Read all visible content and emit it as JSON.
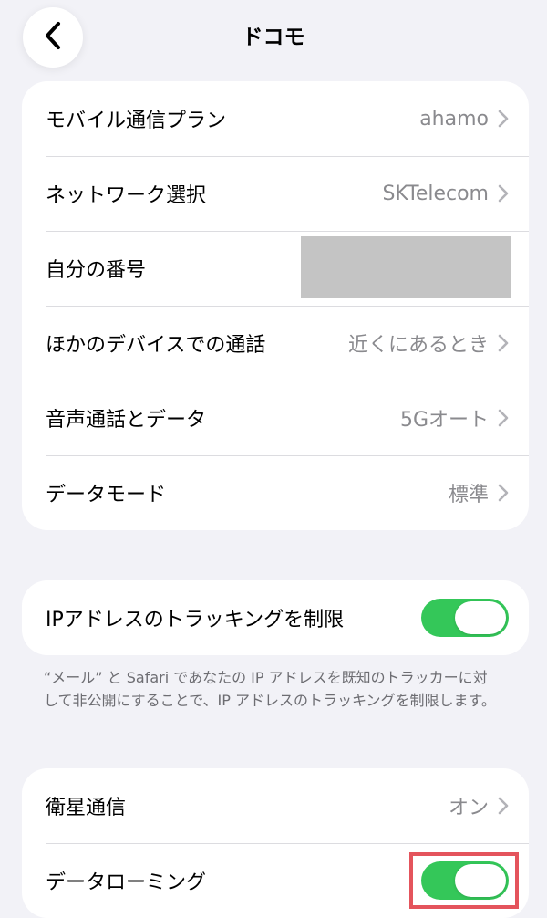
{
  "header": {
    "title": "ドコモ",
    "back_icon": "chevron-left-icon"
  },
  "carrier_settings": {
    "items": [
      {
        "label": "モバイル通信プラン",
        "value": "ahamo"
      },
      {
        "label": "ネットワーク選択",
        "value": "SKTelecom"
      },
      {
        "label": "自分の番号",
        "value": ""
      },
      {
        "label": "ほかのデバイスでの通話",
        "value": "近くにあるとき"
      },
      {
        "label": "音声通話とデータ",
        "value": "5Gオート"
      },
      {
        "label": "データモード",
        "value": "標準"
      }
    ]
  },
  "privacy": {
    "label": "IPアドレスのトラッキングを制限",
    "enabled": true,
    "footnote": "“メール” と Safari であなたの IP アドレスを既知のトラッカーに対して非公開にすることで、IP アドレスのトラッキングを制限します。"
  },
  "roaming": {
    "satellite": {
      "label": "衛星通信",
      "value": "オン"
    },
    "data_roaming": {
      "label": "データローミング",
      "enabled": true
    }
  },
  "colors": {
    "background": "#f2f2f7",
    "toggle_on": "#34c759",
    "highlight": "#e4545c",
    "secondary_text": "#8a8a8e"
  }
}
